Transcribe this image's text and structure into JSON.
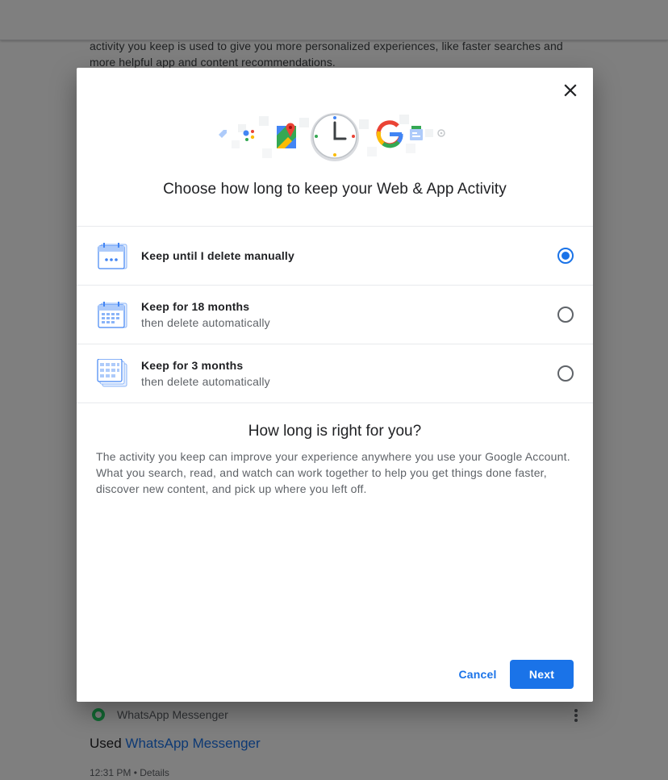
{
  "background": {
    "intro_text": "activity you keep is used to give you more personalized experiences, like faster searches and more helpful app and content recommendations.",
    "app_row": {
      "icon": "whatsapp-icon",
      "name": "WhatsApp Messenger",
      "more_icon": "more-vert-icon"
    },
    "used_prefix": "Used ",
    "used_app_link": "WhatsApp Messenger",
    "time": "12:31 PM • Details"
  },
  "dialog": {
    "close_icon": "close-icon",
    "hero_icon": "activity-illustration-icon",
    "title": "Choose how long to keep your Web & App Activity",
    "options": [
      {
        "label": "Keep until I delete manually",
        "sublabel": "",
        "icon": "calendar-infinite-icon",
        "selected": true
      },
      {
        "label": "Keep for 18 months",
        "sublabel": "then delete automatically",
        "icon": "calendar-18-months-icon",
        "selected": false
      },
      {
        "label": "Keep for 3 months",
        "sublabel": "then delete automatically",
        "icon": "calendar-3-months-icon",
        "selected": false
      }
    ],
    "info_title": "How long is right for you?",
    "info_body": "The activity you keep can improve your experience anywhere you use your Google Account. What you search, read, and watch can work together to help you get things done faster, discover new content, and pick up where you left off.",
    "cancel_label": "Cancel",
    "next_label": "Next"
  },
  "colors": {
    "accent": "#1a73e8",
    "text_primary": "#202124",
    "text_secondary": "#5f6368",
    "scrim": "rgba(0,0,0,0.5)"
  }
}
